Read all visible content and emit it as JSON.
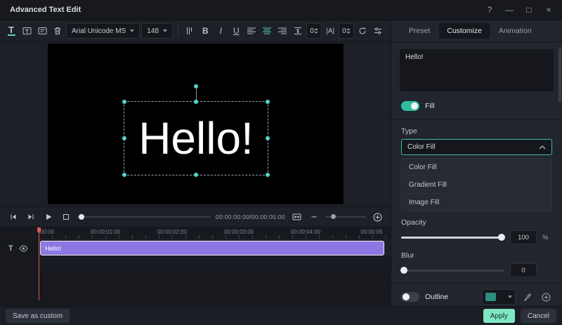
{
  "window": {
    "title": "Advanced Text Edit",
    "help": "?",
    "minimize": "—",
    "maximize": "□",
    "close": "×"
  },
  "toolbar": {
    "font_family": "Arial Unicode MS",
    "font_size": "148",
    "bold": "B",
    "italic": "I",
    "underline": "U",
    "tracking_icon": "|A|",
    "line_spacing": "0",
    "letter_spacing": "0"
  },
  "canvas": {
    "text": "Hello!"
  },
  "transport": {
    "timecode": "00:00:00:00/00:00:05:00"
  },
  "timeline": {
    "ruler": [
      "00:00",
      "00:00:01:00",
      "00:00:02:00",
      "00:00:03:00",
      "00:00:04:00",
      "00:00:05"
    ],
    "clip_label": "Hello!"
  },
  "panel": {
    "tabs": [
      "Preset",
      "Customize",
      "Animation"
    ],
    "active_tab": "Customize",
    "text_value": "Hello!",
    "fill_label": "Fill",
    "type_label": "Type",
    "type_selected": "Color Fill",
    "type_options": [
      "Color Fill",
      "Gradient Fill",
      "Image Fill"
    ],
    "opacity_label": "Opacity",
    "opacity_value": "100",
    "opacity_unit": "%",
    "blur_label": "Blur",
    "blur_value": "0",
    "outline_label": "Outline"
  },
  "footer": {
    "save_as_custom": "Save as custom",
    "apply": "Apply",
    "cancel": "Cancel"
  },
  "colors": {
    "accent": "#5fd7b4",
    "apply_button": "#7fe7c3",
    "clip": "#8c77e4",
    "playhead": "#e05548",
    "selection_handle": "#4fd8c6",
    "outline_swatch": "#2c8d7f"
  }
}
